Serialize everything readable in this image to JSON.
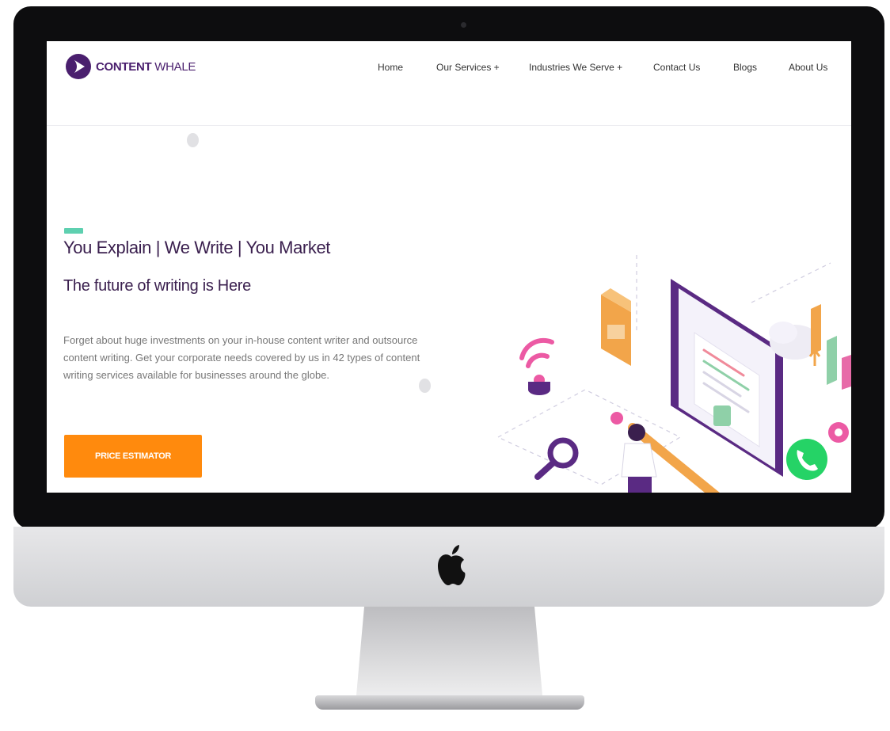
{
  "brand": {
    "name_bold": "CONTENT",
    "name_light": " WHALE"
  },
  "nav": {
    "items": [
      {
        "label": "Home"
      },
      {
        "label": "Our Services +"
      },
      {
        "label": "Industries We Serve +"
      },
      {
        "label": "Contact Us"
      },
      {
        "label": "Blogs"
      },
      {
        "label": "About Us"
      }
    ]
  },
  "hero": {
    "headline": "You Explain | We Write | You Market",
    "subheadline": "The future of writing is Here",
    "description": "Forget about huge investments on your in-house content writer and outsource content writing. Get your corporate needs covered by us in 42 types of content writing services available for businesses around the globe.",
    "cta_label": "PRICE ESTIMATOR"
  },
  "colors": {
    "brand_purple": "#4a1f6e",
    "cta_orange": "#ff8a0d",
    "accent_teal": "#5ed0b0",
    "whatsapp_green": "#25d366"
  },
  "icons": [
    "apple-logo-icon",
    "whatsapp-icon",
    "magnifier-icon",
    "wifi-signal-icon",
    "folder-icon",
    "cloud-upload-icon",
    "gear-icon",
    "pencil-icon"
  ]
}
